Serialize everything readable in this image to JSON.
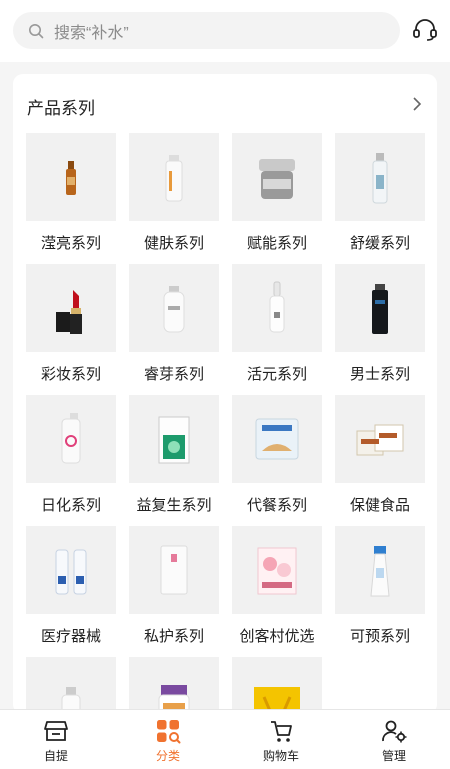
{
  "search": {
    "placeholder": "搜索“补水”",
    "icon": "search-icon"
  },
  "header": {
    "support_icon": "headset-icon"
  },
  "section": {
    "title": "产品系列",
    "more_icon": "chevron-right-icon"
  },
  "categories": [
    {
      "label": "滢亮系列",
      "product": "amber-ampoule"
    },
    {
      "label": "健肤系列",
      "product": "white-spray-bottle"
    },
    {
      "label": "赋能系列",
      "product": "silver-cream-jar"
    },
    {
      "label": "舒缓系列",
      "product": "clear-spray-bottle"
    },
    {
      "label": "彩妆系列",
      "product": "red-lipstick"
    },
    {
      "label": "睿芽系列",
      "product": "pump-bottle"
    },
    {
      "label": "活元系列",
      "product": "dropper-bottle"
    },
    {
      "label": "男士系列",
      "product": "black-bottle"
    },
    {
      "label": "日化系列",
      "product": "pink-pump-bottle"
    },
    {
      "label": "益复生系列",
      "product": "green-box"
    },
    {
      "label": "代餐系列",
      "product": "meal-pack"
    },
    {
      "label": "保健食品",
      "product": "supplement-boxes"
    },
    {
      "label": "医疗器械",
      "product": "blue-tubes"
    },
    {
      "label": "私护系列",
      "product": "white-sachet"
    },
    {
      "label": "创客村优选",
      "product": "floral-pack"
    },
    {
      "label": "可预系列",
      "product": "blue-cap-tube"
    },
    {
      "label": "",
      "product": "spray-bottle-partial"
    },
    {
      "label": "",
      "product": "supplement-jar-partial"
    },
    {
      "label": "",
      "product": "yellow-box-partial"
    }
  ],
  "tabbar": {
    "active": "分类",
    "accent": "#f0722f",
    "items": [
      {
        "label": "自提",
        "icon": "store-icon"
      },
      {
        "label": "分类",
        "icon": "category-icon"
      },
      {
        "label": "购物车",
        "icon": "cart-icon"
      },
      {
        "label": "管理",
        "icon": "user-settings-icon"
      }
    ]
  }
}
